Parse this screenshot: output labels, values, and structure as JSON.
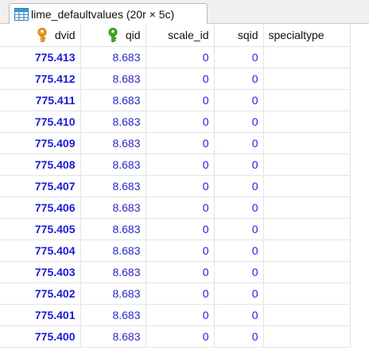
{
  "tab": {
    "icon": "table-icon",
    "title": "lime_defaultvalues (20r × 5c)"
  },
  "columns": [
    {
      "label": "dvid",
      "icon": "primary-key-icon",
      "icon_color": "#f0a020"
    },
    {
      "label": "qid",
      "icon": "foreign-key-icon",
      "icon_color": "#48b020"
    },
    {
      "label": "scale_id"
    },
    {
      "label": "sqid"
    },
    {
      "label": "specialtype"
    }
  ],
  "rows": [
    {
      "dvid": "775.413",
      "qid": "8.683",
      "scale_id": "0",
      "sqid": "0",
      "specialtype": ""
    },
    {
      "dvid": "775.412",
      "qid": "8.683",
      "scale_id": "0",
      "sqid": "0",
      "specialtype": ""
    },
    {
      "dvid": "775.411",
      "qid": "8.683",
      "scale_id": "0",
      "sqid": "0",
      "specialtype": ""
    },
    {
      "dvid": "775.410",
      "qid": "8.683",
      "scale_id": "0",
      "sqid": "0",
      "specialtype": ""
    },
    {
      "dvid": "775.409",
      "qid": "8.683",
      "scale_id": "0",
      "sqid": "0",
      "specialtype": ""
    },
    {
      "dvid": "775.408",
      "qid": "8.683",
      "scale_id": "0",
      "sqid": "0",
      "specialtype": ""
    },
    {
      "dvid": "775.407",
      "qid": "8.683",
      "scale_id": "0",
      "sqid": "0",
      "specialtype": ""
    },
    {
      "dvid": "775.406",
      "qid": "8.683",
      "scale_id": "0",
      "sqid": "0",
      "specialtype": ""
    },
    {
      "dvid": "775.405",
      "qid": "8.683",
      "scale_id": "0",
      "sqid": "0",
      "specialtype": ""
    },
    {
      "dvid": "775.404",
      "qid": "8.683",
      "scale_id": "0",
      "sqid": "0",
      "specialtype": ""
    },
    {
      "dvid": "775.403",
      "qid": "8.683",
      "scale_id": "0",
      "sqid": "0",
      "specialtype": ""
    },
    {
      "dvid": "775.402",
      "qid": "8.683",
      "scale_id": "0",
      "sqid": "0",
      "specialtype": ""
    },
    {
      "dvid": "775.401",
      "qid": "8.683",
      "scale_id": "0",
      "sqid": "0",
      "specialtype": ""
    },
    {
      "dvid": "775.400",
      "qid": "8.683",
      "scale_id": "0",
      "sqid": "0",
      "specialtype": ""
    }
  ]
}
